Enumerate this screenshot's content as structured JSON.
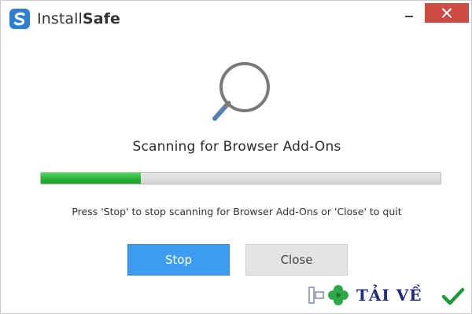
{
  "window": {
    "title_regular": "Install",
    "title_bold": "Safe"
  },
  "titlebar": {
    "minimize_icon": "minimize-icon",
    "close_icon": "close-x-icon",
    "close_color": "#cc4b44"
  },
  "main": {
    "icon": "magnifier-icon",
    "heading": "Scanning for Browser Add-Ons",
    "progress_fraction": 0.25,
    "hint": "Press 'Stop' to stop scanning for Browser Add-Ons or 'Close' to quit"
  },
  "buttons": {
    "stop_label": "Stop",
    "close_label": "Close",
    "stop_color": "#3d9cf0"
  },
  "watermark": {
    "text": "TẢI VỀ",
    "icons": [
      "pc-icon",
      "clover-icon",
      "checkmark-icon"
    ]
  }
}
